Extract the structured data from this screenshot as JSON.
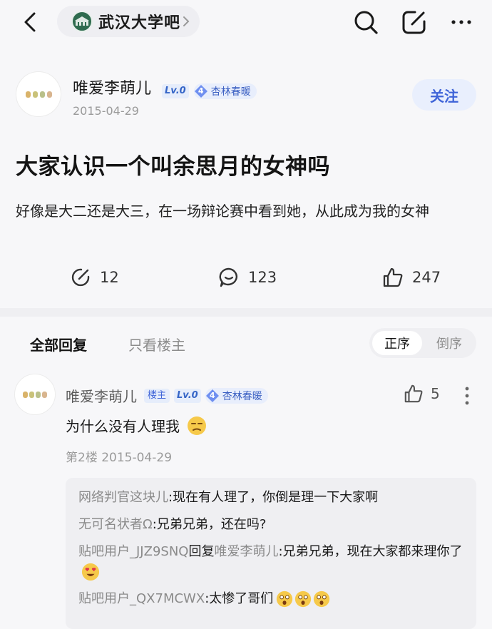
{
  "header": {
    "forum_name": "武汉大学吧"
  },
  "author": {
    "name": "唯爱李萌儿",
    "level": "Lv.0",
    "title_level": "4",
    "title": "杏林春暖",
    "date": "2015-04-29",
    "follow_label": "关注"
  },
  "post": {
    "title": "大家认识一个叫余思月的女神吗",
    "body": "好像是大二还是大三，在一场辩论赛中看到她，从此成为我的女神",
    "shares": "12",
    "comments": "123",
    "likes": "247"
  },
  "tabs": {
    "all": "全部回复",
    "owner_only": "只看楼主",
    "order_asc": "正序",
    "order_desc": "倒序"
  },
  "reply": {
    "name": "唯爱李萌儿",
    "owner_badge": "楼主",
    "level": "Lv.0",
    "title_level": "4",
    "title": "杏林春暖",
    "likes": "5",
    "text": "为什么没有人理我",
    "meta": "第2楼 2015-04-29",
    "subreplies": [
      {
        "user": "网络判官这块儿",
        "sep": ":",
        "text": "现在有人理了，你倒是理一下大家啊"
      },
      {
        "user": "无可名状者Ω",
        "sep": ":",
        "text": "兄弟兄弟，还在吗?"
      },
      {
        "user": "贴吧用户_JJZ9SNQ",
        "mid": "回复",
        "target": "唯爱李萌儿",
        "sep": ":",
        "text": "兄弟兄弟，现在大家都来理你了"
      },
      {
        "user": "贴吧用户_QX7MCWX",
        "sep": ":",
        "text": "太惨了哥们"
      }
    ]
  },
  "colors": {
    "accent": "#3f64d8",
    "forum_logo": "#2f6b4f"
  }
}
